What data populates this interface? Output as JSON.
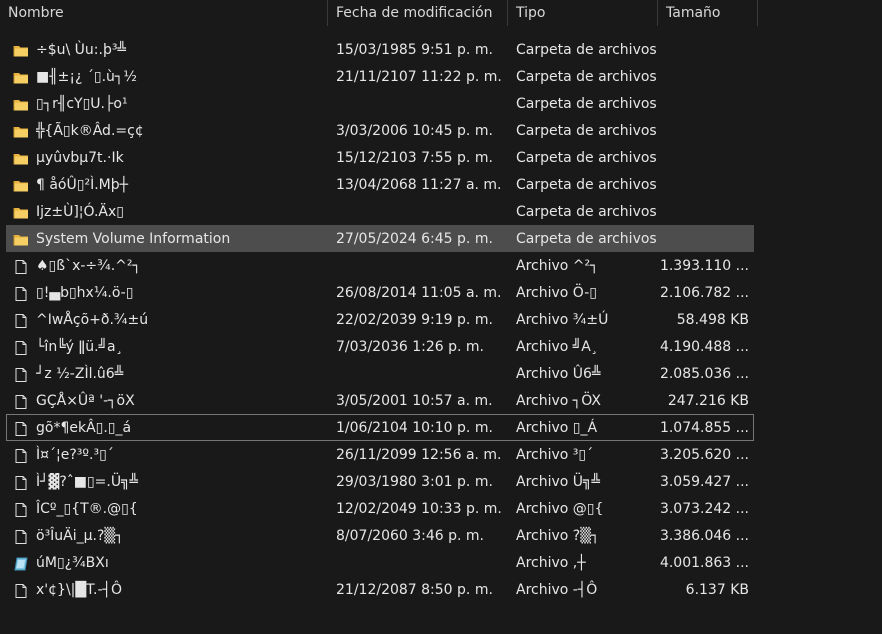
{
  "columns": {
    "name": "Nombre",
    "date": "Fecha de modificación",
    "type": "Tipo",
    "size": "Tamaño"
  },
  "sort_arrow": "^",
  "rows": [
    {
      "icon": "folder-icon",
      "name": "÷$u\\ Ùu:.þ³╩",
      "date": "15/03/1985 9:51 p. m.",
      "type": "Carpeta de archivos",
      "size": ""
    },
    {
      "icon": "folder-icon",
      "name": "■╢±¡¿ ´▯.ù┐½",
      "date": "21/11/2107 11:22 p. m.",
      "type": "Carpeta de archivos",
      "size": ""
    },
    {
      "icon": "folder-icon",
      "name": "▯┐r╢cY▯U.├o¹",
      "date": "",
      "type": "Carpeta de archivos",
      "size": ""
    },
    {
      "icon": "folder-icon",
      "name": "╬{Ã▯k®Âd.=ç¢",
      "date": "3/03/2006 10:45 p. m.",
      "type": "Carpeta de archivos",
      "size": ""
    },
    {
      "icon": "folder-icon",
      "name": "µyûvbµ7t.·Ik",
      "date": "15/12/2103 7:55 p. m.",
      "type": "Carpeta de archivos",
      "size": ""
    },
    {
      "icon": "folder-icon",
      "name": "¶  åóÛ▯²Ì.Mþ┼",
      "date": "13/04/2068 11:27 a. m.",
      "type": "Carpeta de archivos",
      "size": ""
    },
    {
      "icon": "folder-icon",
      "name": "Ijz±Ù]¦Ó.Äx▯",
      "date": "",
      "type": "Carpeta de archivos",
      "size": ""
    },
    {
      "icon": "folder-icon",
      "name": "System Volume Information",
      "date": "27/05/2024 6:45 p. m.",
      "type": "Carpeta de archivos",
      "size": "",
      "selected": true
    },
    {
      "icon": "file-icon",
      "name": "♠▯ß`x-÷¾.^²┐",
      "date": "",
      "type": "Archivo ^²┐",
      "size": "1.393.110 ..."
    },
    {
      "icon": "file-icon",
      "name": "▯!▄b▯hx¼.ö-▯",
      "date": "26/08/2014 11:05 a. m.",
      "type": "Archivo Ö-▯",
      "size": "2.106.782 ..."
    },
    {
      "icon": "file-icon",
      "name": "^IwÅçõ+ð.¾±ú",
      "date": "22/02/2039 9:19 p. m.",
      "type": "Archivo ¾±Ú",
      "size": "58.498 KB"
    },
    {
      "icon": "file-icon",
      "name": "└în╚ý ǁü.╝a¸",
      "date": "7/03/2036 1:26 p. m.",
      "type": "Archivo ╝A¸",
      "size": "4.190.488 ..."
    },
    {
      "icon": "file-icon",
      "name": "┘z ½-ZÌl.û6╩",
      "date": "",
      "type": "Archivo Û6╩",
      "size": "2.085.036 ..."
    },
    {
      "icon": "file-icon",
      "name": "GÇÅ×Ûª '-┐öX",
      "date": "3/05/2001 10:57 a. m.",
      "type": "Archivo ┐ÖX",
      "size": "247.216 KB"
    },
    {
      "icon": "file-icon",
      "name": "gõ*¶ekÂ▯.▯_á",
      "date": "1/06/2104 10:10 p. m.",
      "type": "Archivo ▯_Á",
      "size": "1.074.855 ...",
      "focused": true
    },
    {
      "icon": "file-icon",
      "name": "Ì¤´¦e?³º.³▯´",
      "date": "26/11/2099 12:56 a. m.",
      "type": "Archivo ³▯´",
      "size": "3.205.620 ..."
    },
    {
      "icon": "file-icon",
      "name": "Ì┘▓?ˆ■▯=.Ü╗╩",
      "date": "29/03/1980 3:01 p. m.",
      "type": "Archivo Ü╗╩",
      "size": "3.059.427 ..."
    },
    {
      "icon": "file-icon",
      "name": "ÎCº_▯{T®.@▯{",
      "date": "12/02/2049 10:33 p. m.",
      "type": "Archivo @▯{",
      "size": "3.073.242 ..."
    },
    {
      "icon": "file-icon",
      "name": "ö³ÎuÄi_µ.?▒┐",
      "date": "8/07/2060 3:46 p. m.",
      "type": "Archivo ?▒┐",
      "size": "3.386.046 ..."
    },
    {
      "icon": "disk-image-icon",
      "name": "úM▯¿¾BXı",
      "date": "",
      "type": "Archivo ,┼",
      "size": "4.001.863 ..."
    },
    {
      "icon": "file-icon",
      "name": "x'¢}\\|█T.-┤Ô",
      "date": "21/12/2087 8:50 p. m.",
      "type": "Archivo -┤Ô",
      "size": "6.137 KB"
    }
  ],
  "colors": {
    "background": "#191919",
    "selected_row": "#4d4d4d",
    "folder": "#f2c55c",
    "text": "#e6e6e6"
  }
}
